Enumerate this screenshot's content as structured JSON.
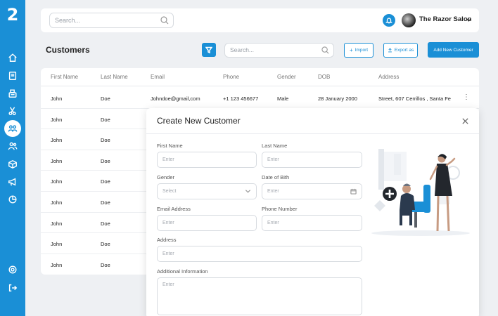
{
  "app": {
    "logo_text": "2"
  },
  "sidebar": {
    "items": [
      {
        "name": "home",
        "icon": "home-icon",
        "active": false
      },
      {
        "name": "appointments",
        "icon": "book-icon",
        "active": false
      },
      {
        "name": "register",
        "icon": "cash-register-icon",
        "active": false
      },
      {
        "name": "services",
        "icon": "scissors-icon",
        "active": false
      },
      {
        "name": "customers",
        "icon": "customers-icon",
        "active": true
      },
      {
        "name": "staff",
        "icon": "staff-icon",
        "active": false
      },
      {
        "name": "inventory",
        "icon": "box-icon",
        "active": false
      },
      {
        "name": "marketing",
        "icon": "megaphone-icon",
        "active": false
      },
      {
        "name": "reports",
        "icon": "pie-chart-icon",
        "active": false
      }
    ],
    "bottom": [
      {
        "name": "settings",
        "icon": "gear-icon"
      },
      {
        "name": "logout",
        "icon": "logout-icon"
      }
    ]
  },
  "topbar": {
    "search_placeholder": "Search...",
    "notification_icon": "bell-icon",
    "user_name": "The Razor Salon"
  },
  "page": {
    "title": "Customers",
    "search_placeholder": "Search...",
    "import_label": "Import",
    "export_label": "Export as",
    "add_label": "Add New Customer",
    "accent_color": "#1a8fd6"
  },
  "table": {
    "columns": [
      "First Name",
      "Last Name",
      "Email",
      "Phone",
      "Gender",
      "DOB",
      "Address"
    ],
    "rows": [
      {
        "first": "John",
        "last": "Doe",
        "email": "Johndoe@gmail,com",
        "phone": "+1 123 456677",
        "gender": "Male",
        "dob": "28 January 2000",
        "address": "Street, 607 Cerrillos , Santa Fe"
      },
      {
        "first": "John",
        "last": "Doe"
      },
      {
        "first": "John",
        "last": "Doe"
      },
      {
        "first": "John",
        "last": "Doe"
      },
      {
        "first": "John",
        "last": "Doe"
      },
      {
        "first": "John",
        "last": "Doe"
      },
      {
        "first": "John",
        "last": "Doe"
      },
      {
        "first": "John",
        "last": "Doe"
      },
      {
        "first": "John",
        "last": "Doe"
      }
    ]
  },
  "modal": {
    "title": "Create New Customer",
    "fields": {
      "first_name": {
        "label": "First Name",
        "placeholder": "Enter"
      },
      "last_name": {
        "label": "Last Name",
        "placeholder": "Enter"
      },
      "gender": {
        "label": "Gender",
        "placeholder": "Select"
      },
      "dob": {
        "label": "Date of Bith",
        "placeholder": "Enter"
      },
      "email": {
        "label": "Email Address",
        "placeholder": "Enter"
      },
      "phone": {
        "label": "Phone Number",
        "placeholder": "Enter"
      },
      "address": {
        "label": "Address",
        "placeholder": "Enter"
      },
      "info": {
        "label": "Additional Information",
        "placeholder": "Enter"
      }
    }
  }
}
